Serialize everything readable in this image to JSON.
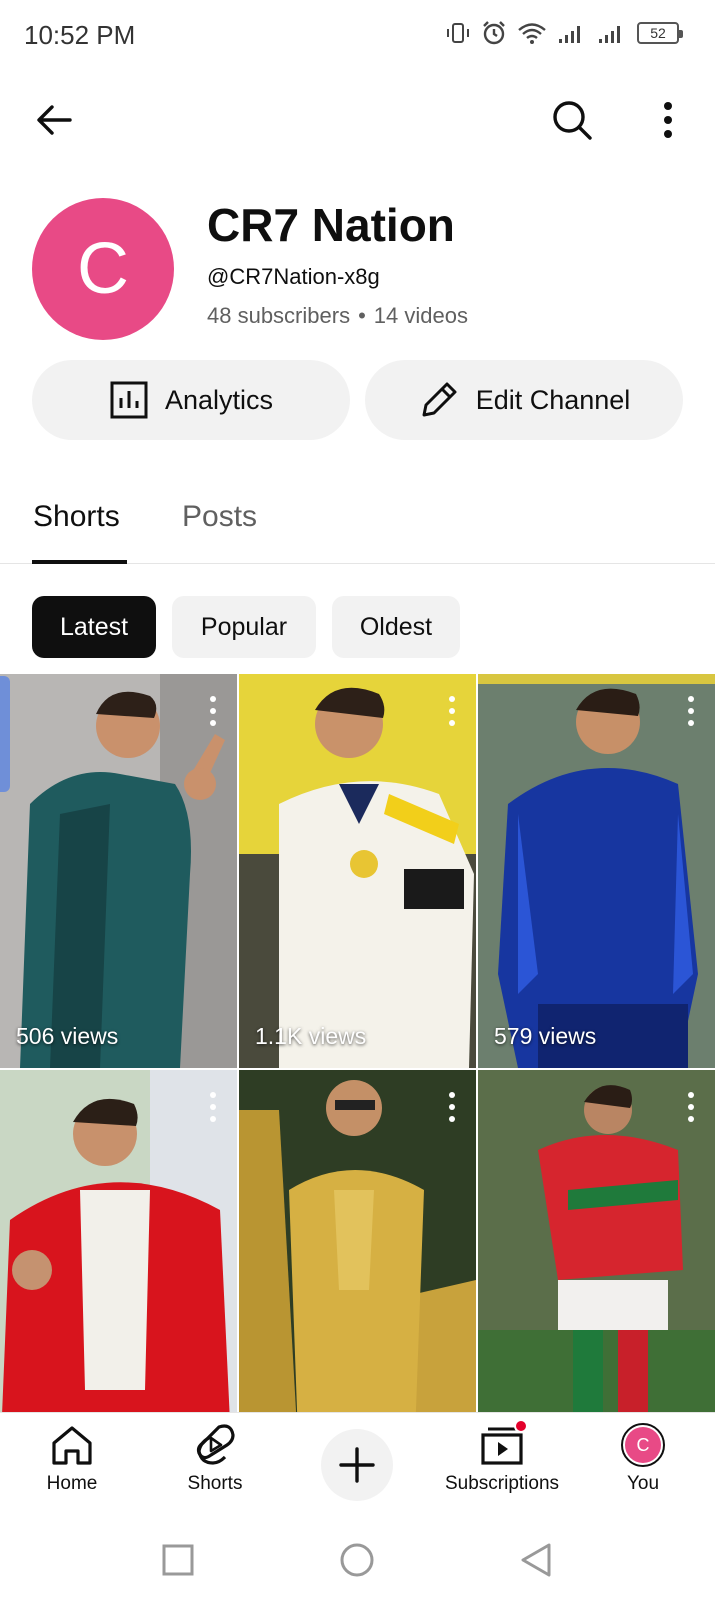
{
  "status_bar": {
    "time": "10:52 PM",
    "battery": "52"
  },
  "channel": {
    "avatar_letter": "C",
    "name": "CR7 Nation",
    "handle": "@CR7Nation-x8g",
    "subscribers": "48 subscribers",
    "separator": "•",
    "videos": "14 videos",
    "avatar_color": "#e84a86"
  },
  "actions": {
    "analytics_label": "Analytics",
    "edit_label": "Edit Channel"
  },
  "tabs": {
    "shorts": "Shorts",
    "posts": "Posts",
    "active": "Shorts"
  },
  "chips": {
    "latest": "Latest",
    "popular": "Popular",
    "oldest": "Oldest",
    "active": "Latest"
  },
  "shorts": [
    {
      "views": "506 views",
      "scene": "player in teal jacket making peace sign"
    },
    {
      "views": "1.1K views",
      "scene": "player in white and yellow jersey with captain armband"
    },
    {
      "views": "579 views",
      "scene": "player in blue training top"
    },
    {
      "views": "",
      "scene": "player in red jacket giving thumbs up"
    },
    {
      "views": "",
      "scene": "man in gold suit by gold car"
    },
    {
      "views": "",
      "scene": "player in red and green kit running"
    }
  ],
  "bottom_nav": {
    "home": "Home",
    "shorts": "Shorts",
    "subscriptions": "Subscriptions",
    "you": "You",
    "you_avatar_letter": "C"
  },
  "icons": {
    "back": "arrow-left-icon",
    "search": "search-icon",
    "more": "more-vertical-icon",
    "analytics": "analytics-icon",
    "edit": "pencil-icon",
    "home": "home-icon",
    "shorts": "shorts-icon",
    "create": "plus-icon",
    "subscriptions": "subscriptions-icon"
  }
}
